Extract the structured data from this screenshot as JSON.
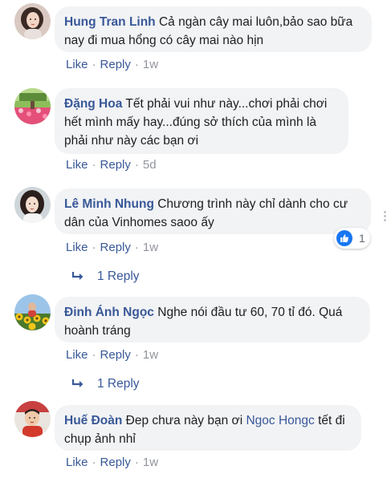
{
  "comments": [
    {
      "author": "Hung Tran Linh",
      "text": "Cả ngàn cây mai luôn,bảo sao bữa nay đi mua hổng có cây mai nào hịn",
      "like_label": "Like",
      "reply_label": "Reply",
      "time": "1w",
      "avatar_icon": "woman-portrait-avatar"
    },
    {
      "author": "Đặng Hoa",
      "text": "Tết phải vui như này...chơi phải chơi hết mình mấy hay...đúng sở thích của mình là phải như này các bạn ơi",
      "like_label": "Like",
      "reply_label": "Reply",
      "time": "5d",
      "avatar_icon": "flower-garden-avatar"
    },
    {
      "author": "Lê Minh Nhung",
      "text": "Chương trình này chỉ dành cho cư dân của Vinhomes saoo ấy",
      "like_label": "Like",
      "reply_label": "Reply",
      "time": "1w",
      "avatar_icon": "woman-portrait-avatar",
      "reaction": {
        "icon": "thumbs-up-icon",
        "count": "1",
        "color": "#1877f2"
      },
      "replies_label": "1 Reply"
    },
    {
      "author": "Đinh Ánh Ngọc",
      "text": "Nghe nói đầu tư 60, 70 tỉ đó. Quá hoành tráng",
      "like_label": "Like",
      "reply_label": "Reply",
      "time": "1w",
      "avatar_icon": "sunflower-field-avatar",
      "replies_label": "1 Reply"
    },
    {
      "author": "Huế Đoàn",
      "text_before": "Đep chưa này bạn ơi",
      "mention": "Ngoc Hongc",
      "text_after": "tết đi chụp ảnh nhỉ",
      "like_label": "Like",
      "reply_label": "Reply",
      "time": "1w",
      "avatar_icon": "child-photo-avatar"
    }
  ],
  "colors": {
    "link": "#385898",
    "bubble": "#f2f3f5",
    "meta": "#90949c",
    "like_blue": "#1877f2"
  }
}
